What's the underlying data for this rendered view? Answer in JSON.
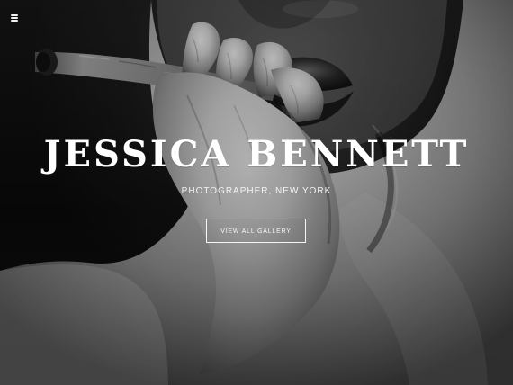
{
  "header": {
    "menu_icon": "hamburger-menu-icon"
  },
  "hero": {
    "title": "JESSICA BENNETT",
    "subtitle": "PHOTOGRAPHER, NEW YORK",
    "button_label": "VIEW ALL GALLERY"
  },
  "theme": {
    "background": "#0d0d0d",
    "foreground": "#ffffff"
  }
}
